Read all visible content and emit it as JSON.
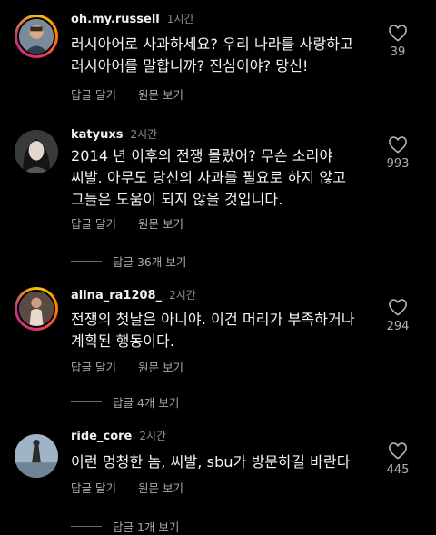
{
  "comments": [
    {
      "username": "oh.my.russell",
      "time": "1시간",
      "lines": [
        "러시아어로 사과하세요? 우리 나라를 사랑하고",
        "러시아어를 말합니까? 진심이야? 망신!"
      ],
      "reply_label": "답글 달기",
      "original_label": "원문 보기",
      "likes": "39"
    },
    {
      "username": "katyuxs",
      "time": "2시간",
      "lines": [
        "2014 년 이후의 전쟁 몰랐어? 무슨 소리야",
        "씨발. 아무도 당신의 사과를 필요로 하지 않고",
        "그들은 도움이 되지 않을 것입니다."
      ],
      "reply_label": "답글 달기",
      "original_label": "원문 보기",
      "likes": "993",
      "view_replies": "답글 36개 보기"
    },
    {
      "username": "alina_ra1208_",
      "time": "2시간",
      "lines": [
        "전쟁의 첫날은 아니야. 이건 머리가 부족하거나",
        "계획된 행동이다."
      ],
      "reply_label": "답글 달기",
      "original_label": "원문 보기",
      "likes": "294",
      "view_replies": "답글 4개 보기"
    },
    {
      "username": "ride_core",
      "time": "2시간",
      "lines": [
        "이런 멍청한 놈, 씨발, sbu가 방문하길 바란다"
      ],
      "reply_label": "답글 달기",
      "original_label": "원문 보기",
      "likes": "445",
      "view_replies": "답글 1개 보기"
    }
  ],
  "icons": {
    "like": "heart-outline-icon"
  },
  "colors": {
    "background": "#000000",
    "text": "#f5f5f5",
    "muted": "#a8a8a8"
  }
}
